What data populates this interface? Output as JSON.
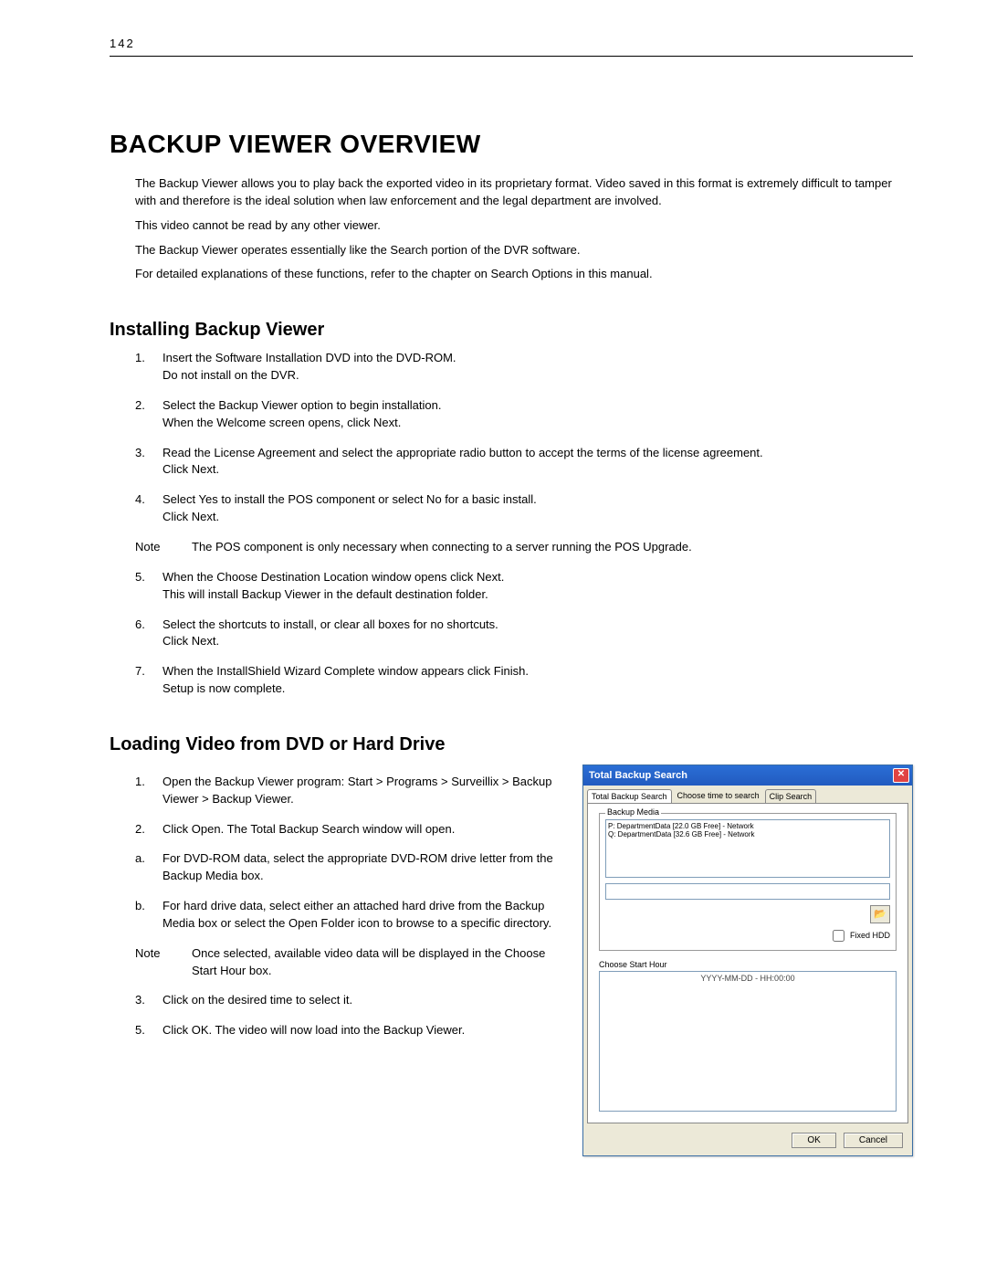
{
  "page_number": "142",
  "h1": "BACKUP VIEWER OVERVIEW",
  "intro": {
    "p1": "The Backup Viewer allows you to play back the exported video in its proprietary format. Video saved in this format is extremely difficult to tamper with and therefore is the ideal solution when law enforcement and the legal department are involved.",
    "p2": "This video cannot be read by any other viewer.",
    "p3": "The Backup Viewer operates essentially like the Search portion of the DVR software.",
    "p4": "For detailed explanations of these functions, refer to the chapter on Search Options in this manual."
  },
  "h2_install": "Installing Backup Viewer",
  "install_steps": [
    {
      "n": "1.",
      "t": "Insert the Software Installation DVD into the DVD-ROM.\nDo not install on the DVR."
    },
    {
      "n": "2.",
      "t": "Select the Backup Viewer option to begin installation.\nWhen the Welcome screen opens, click Next."
    },
    {
      "n": "3.",
      "t": "Read the License Agreement and select the appropriate radio button to accept the terms of the license agreement.\nClick Next."
    },
    {
      "n": "4.",
      "t": "Select Yes to install the POS component or select No for a basic install.\nClick Next."
    }
  ],
  "install_note": {
    "label": "Note",
    "text": "The POS component is only necessary when connecting to a server running the POS Upgrade."
  },
  "install_steps2": [
    {
      "n": "5.",
      "t": "When the Choose Destination Location window opens click Next.\nThis will install Backup Viewer in the default destination folder."
    },
    {
      "n": "6.",
      "t": "Select the shortcuts to install, or clear all boxes for no shortcuts.\nClick Next."
    },
    {
      "n": "7.",
      "t": "When the InstallShield Wizard Complete window appears click Finish.\nSetup is now complete."
    }
  ],
  "h2_load": "Loading Video from DVD or Hard Drive",
  "load_steps1": [
    {
      "n": "1.",
      "t": "Open the Backup Viewer program: Start > Programs > Surveillix > Backup Viewer > Backup Viewer."
    },
    {
      "n": "2.",
      "t": "Click Open. The Total Backup Search window will open."
    },
    {
      "n": "a.",
      "t": "For DVD-ROM data, select the appropriate DVD-ROM drive letter from the Backup Media box."
    },
    {
      "n": "b.",
      "t": "For hard drive data, select either an attached hard drive from the Backup Media box or select the Open Folder icon to browse to a specific directory."
    }
  ],
  "load_note": {
    "label": "Note",
    "text": "Once selected, available video data will be displayed in the Choose Start Hour box."
  },
  "load_steps2": [
    {
      "n": "3.",
      "t": "Click on the desired time to select it."
    },
    {
      "n": "5.",
      "t": "Click OK. The video will now load into the Backup Viewer."
    }
  ],
  "dialog": {
    "title": "Total Backup Search",
    "tabs": {
      "active": "Total Backup Search",
      "label": "Choose time to search",
      "other": "Clip Search"
    },
    "group_media": "Backup Media",
    "media_items": [
      "P:   DepartmentData [22.0 GB Free] - Network",
      "Q:   DepartmentData [32.6 GB Free] - Network"
    ],
    "fixed_hdd": "Fixed HDD",
    "start_hour_label": "Choose Start Hour",
    "hour_placeholder": "YYYY-MM-DD - HH:00:00",
    "ok": "OK",
    "cancel": "Cancel"
  }
}
